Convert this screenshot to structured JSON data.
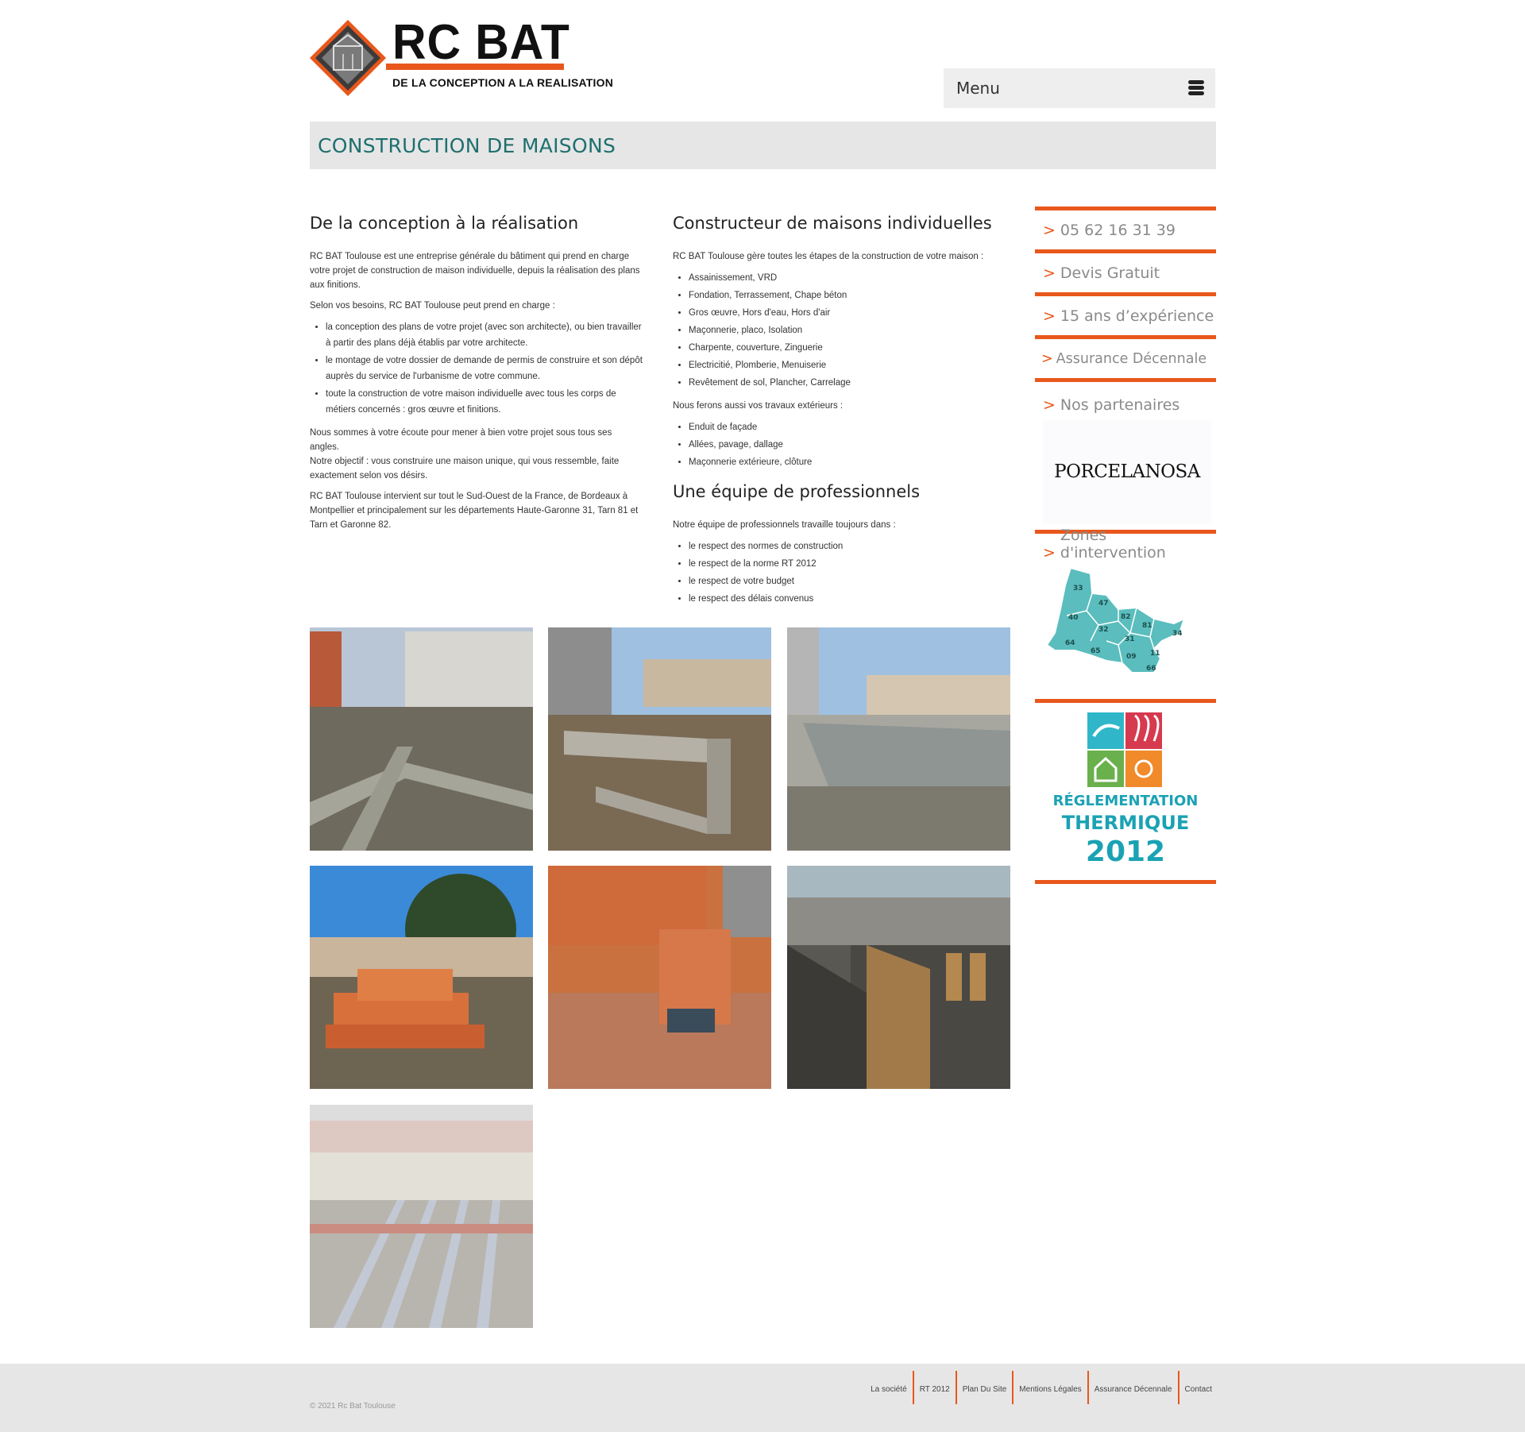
{
  "header": {
    "logo_title": "RC BAT",
    "logo_subtitle": "DE LA CONCEPTION A LA REALISATION",
    "menu_label": "Menu"
  },
  "page_title": "CONSTRUCTION DE MAISONS",
  "col1": {
    "heading": "De la conception à la réalisation",
    "p1": "RC BAT Toulouse est une entreprise générale du bâtiment qui prend en charge votre projet de construction de maison individuelle, depuis la réalisation des plans aux finitions.",
    "p2": "Selon vos besoins, RC BAT Toulouse peut prend en charge :",
    "list": [
      "la conception des plans de votre projet (avec son architecte), ou bien travailler à partir des plans déjà établis par votre architecte.",
      "le montage de votre dossier de demande de permis de construire et son dépôt auprès du service de l'urbanisme de votre commune.",
      "toute la construction de votre maison individuelle avec tous les corps de métiers concernés : gros œuvre et finitions."
    ],
    "p3a": "Nous sommes à votre écoute pour mener à bien votre projet sous tous ses angles.",
    "p3b": "Notre objectif : vous construire une maison unique, qui vous ressemble, faite exactement selon vos désirs.",
    "p4": "RC BAT Toulouse intervient sur tout le Sud-Ouest de la France, de Bordeaux à Montpellier et principalement sur les départements Haute-Garonne 31, Tarn 81 et Tarn et Garonne 82."
  },
  "col2": {
    "heading1": "Constructeur de maisons individuelles",
    "p1": "RC BAT Toulouse gère toutes les étapes de la construction de votre maison :",
    "list1": [
      "Assainissement, VRD",
      "Fondation, Terrassement, Chape béton",
      "Gros œuvre, Hors d'eau, Hors d'air",
      "Maçonnerie, placo, Isolation",
      "Charpente, couverture, Zinguerie",
      "Electricitié, Plomberie, Menuiserie",
      "Revêtement de sol, Plancher, Carrelage"
    ],
    "p2": "Nous ferons aussi vos travaux extérieurs :",
    "list2": [
      "Enduit de façade",
      "Allées, pavage, dallage",
      "Maçonnerie extérieure, clôture"
    ],
    "heading2": "Une équipe de professionnels",
    "p3": "Notre équipe de professionnels travaille toujours dans :",
    "list3": [
      "le respect des normes de construction",
      "le respect de la norme RT 2012",
      "le respect de votre budget",
      "le respect des délais convenus"
    ]
  },
  "sidebar": {
    "arrow": ">",
    "phone": "05 62 16 31 39",
    "devis": "Devis Gratuit",
    "experience": "15 ans d’expérience",
    "assurance": "Assurance Décennale",
    "partners": "Nos partenaires",
    "partner_logo": "PORCELANOSA",
    "zones": "Zones d'intervention",
    "departments": [
      "33",
      "47",
      "40",
      "82",
      "81",
      "32",
      "31",
      "34",
      "64",
      "65",
      "09",
      "11",
      "66"
    ],
    "rt_line1": "RÉGLEMENTATION",
    "rt_line2": "THERMIQUE",
    "rt_line3": "2012"
  },
  "footer": {
    "copyright": "© 2021 Rc Bat Toulouse",
    "links": [
      "La société",
      "RT 2012",
      "Plan Du Site",
      "Mentions Légales",
      "Assurance Décennale",
      "Contact"
    ]
  },
  "colors": {
    "accent": "#e8571b",
    "title_teal": "#1f6f6f",
    "map_teal": "#5bbdbd"
  }
}
